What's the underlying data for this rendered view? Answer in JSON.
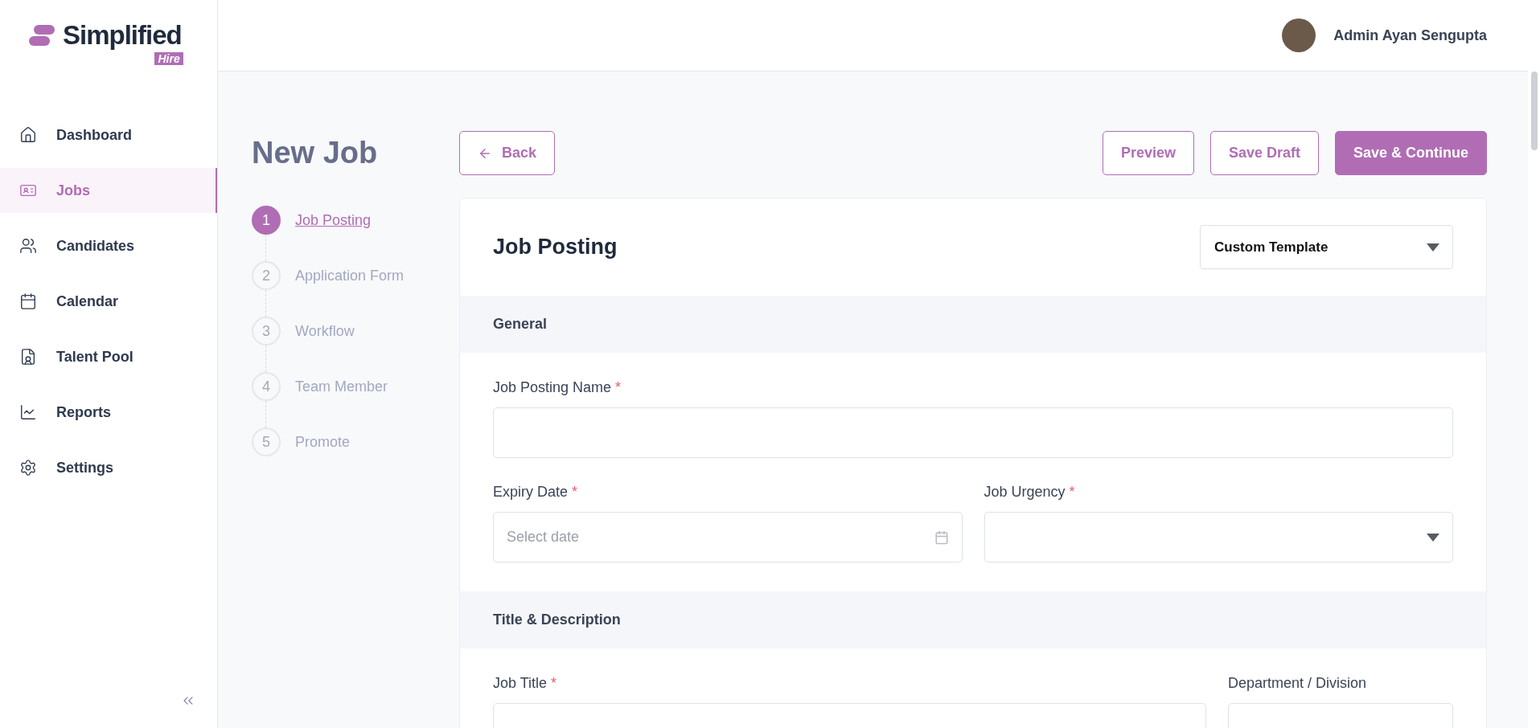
{
  "brand": {
    "name": "Simplified",
    "tag": "Hire"
  },
  "sidebar": {
    "items": [
      {
        "label": "Dashboard",
        "selected": false
      },
      {
        "label": "Jobs",
        "selected": true
      },
      {
        "label": "Candidates",
        "selected": false
      },
      {
        "label": "Calendar",
        "selected": false
      },
      {
        "label": "Talent Pool",
        "selected": false
      },
      {
        "label": "Reports",
        "selected": false
      },
      {
        "label": "Settings",
        "selected": false
      }
    ]
  },
  "user": {
    "name": "Admin Ayan Sengupta"
  },
  "page": {
    "title": "New Job",
    "back": "Back",
    "actions": [
      {
        "label": "Preview",
        "kind": "outline"
      },
      {
        "label": "Save Draft",
        "kind": "outline"
      },
      {
        "label": "Save & Continue",
        "kind": "primary"
      }
    ]
  },
  "steps": [
    {
      "number": "1",
      "label": "Job Posting",
      "selected": true
    },
    {
      "number": "2",
      "label": "Application Form",
      "selected": false
    },
    {
      "number": "3",
      "label": "Workflow",
      "selected": false
    },
    {
      "number": "4",
      "label": "Team Member",
      "selected": false
    },
    {
      "number": "5",
      "label": "Promote",
      "selected": false
    }
  ],
  "card": {
    "title": "Job Posting",
    "template": "Custom Template",
    "sections": [
      {
        "title": "General",
        "rows": [
          [
            {
              "label": "Job Posting Name",
              "required_mark": "*",
              "kind": "text"
            }
          ],
          [
            {
              "label": "Expiry Date",
              "required_mark": "*",
              "kind": "date",
              "placeholder": "Select date"
            },
            {
              "label": "Job Urgency",
              "required_mark": "*",
              "kind": "select"
            }
          ]
        ]
      },
      {
        "title": "Title & Description",
        "rows": [
          [
            {
              "label": "Job Title",
              "required_mark": "*",
              "kind": "text"
            },
            {
              "label": "Department / Division",
              "kind": "text"
            }
          ]
        ]
      }
    ]
  }
}
